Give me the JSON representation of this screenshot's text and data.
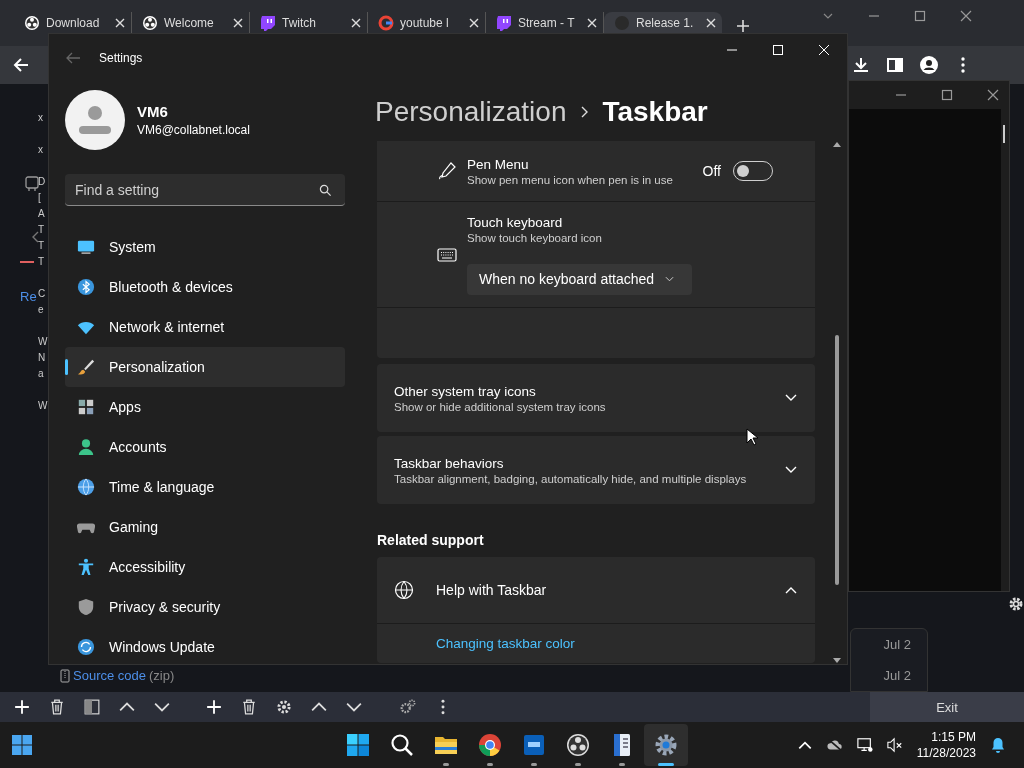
{
  "browser": {
    "tabs": [
      {
        "label": "Download",
        "kind": "obs",
        "selected": false
      },
      {
        "label": "Welcome",
        "kind": "obs",
        "selected": false
      },
      {
        "label": "Twitch",
        "kind": "twitch",
        "selected": false
      },
      {
        "label": "youtube l",
        "kind": "google",
        "selected": false
      },
      {
        "label": "Stream - T",
        "kind": "twitch",
        "selected": false
      },
      {
        "label": "Release 1.",
        "kind": "github",
        "selected": true
      }
    ]
  },
  "background_page": {
    "left_snippets": [
      [
        "x"
      ],
      [
        "x"
      ],
      [
        "D",
        "[",
        "A",
        "T",
        "T",
        "T"
      ],
      [
        "C",
        "e"
      ],
      [
        "W",
        "N",
        "a"
      ],
      [
        "W"
      ]
    ],
    "link": "Re",
    "download": "Source code",
    "download_suffix": "(zip)",
    "dates": [
      "Jul 2",
      "Jul 2"
    ]
  },
  "settings": {
    "title": "Settings",
    "user": {
      "name": "VM6",
      "email": "VM6@collabnet.local"
    },
    "search": {
      "placeholder": "Find a setting"
    },
    "nav": [
      {
        "label": "System",
        "selected": false
      },
      {
        "label": "Bluetooth & devices",
        "selected": false
      },
      {
        "label": "Network & internet",
        "selected": false
      },
      {
        "label": "Personalization",
        "selected": true
      },
      {
        "label": "Apps",
        "selected": false
      },
      {
        "label": "Accounts",
        "selected": false
      },
      {
        "label": "Time & language",
        "selected": false
      },
      {
        "label": "Gaming",
        "selected": false
      },
      {
        "label": "Accessibility",
        "selected": false
      },
      {
        "label": "Privacy & security",
        "selected": false
      },
      {
        "label": "Windows Update",
        "selected": false
      }
    ],
    "breadcrumb": {
      "parent": "Personalization",
      "current": "Taskbar"
    },
    "rows": [
      {
        "kind": "toggle",
        "title": "Pen Menu",
        "description": "Show pen menu icon when pen is in use",
        "state_label": "Off",
        "on": false
      },
      {
        "kind": "dropdown",
        "title": "Touch keyboard",
        "description": "Show touch keyboard icon",
        "value": "When no keyboard attached"
      },
      {
        "kind": "spacer"
      }
    ],
    "expanders": [
      {
        "title": "Other system tray icons",
        "description": "Show or hide additional system tray icons",
        "expanded": false
      },
      {
        "title": "Taskbar behaviors",
        "description": "Taskbar alignment, badging, automatically hide, and multiple displays",
        "expanded": false
      }
    ],
    "related": {
      "heading": "Related support",
      "title": "Help with Taskbar",
      "expanded": true,
      "links": [
        "Changing taskbar color"
      ]
    }
  },
  "bottom_toolbar": {
    "exit": "Exit"
  },
  "taskbar": {
    "time": "1:15 PM",
    "date": "11/28/2023"
  }
}
